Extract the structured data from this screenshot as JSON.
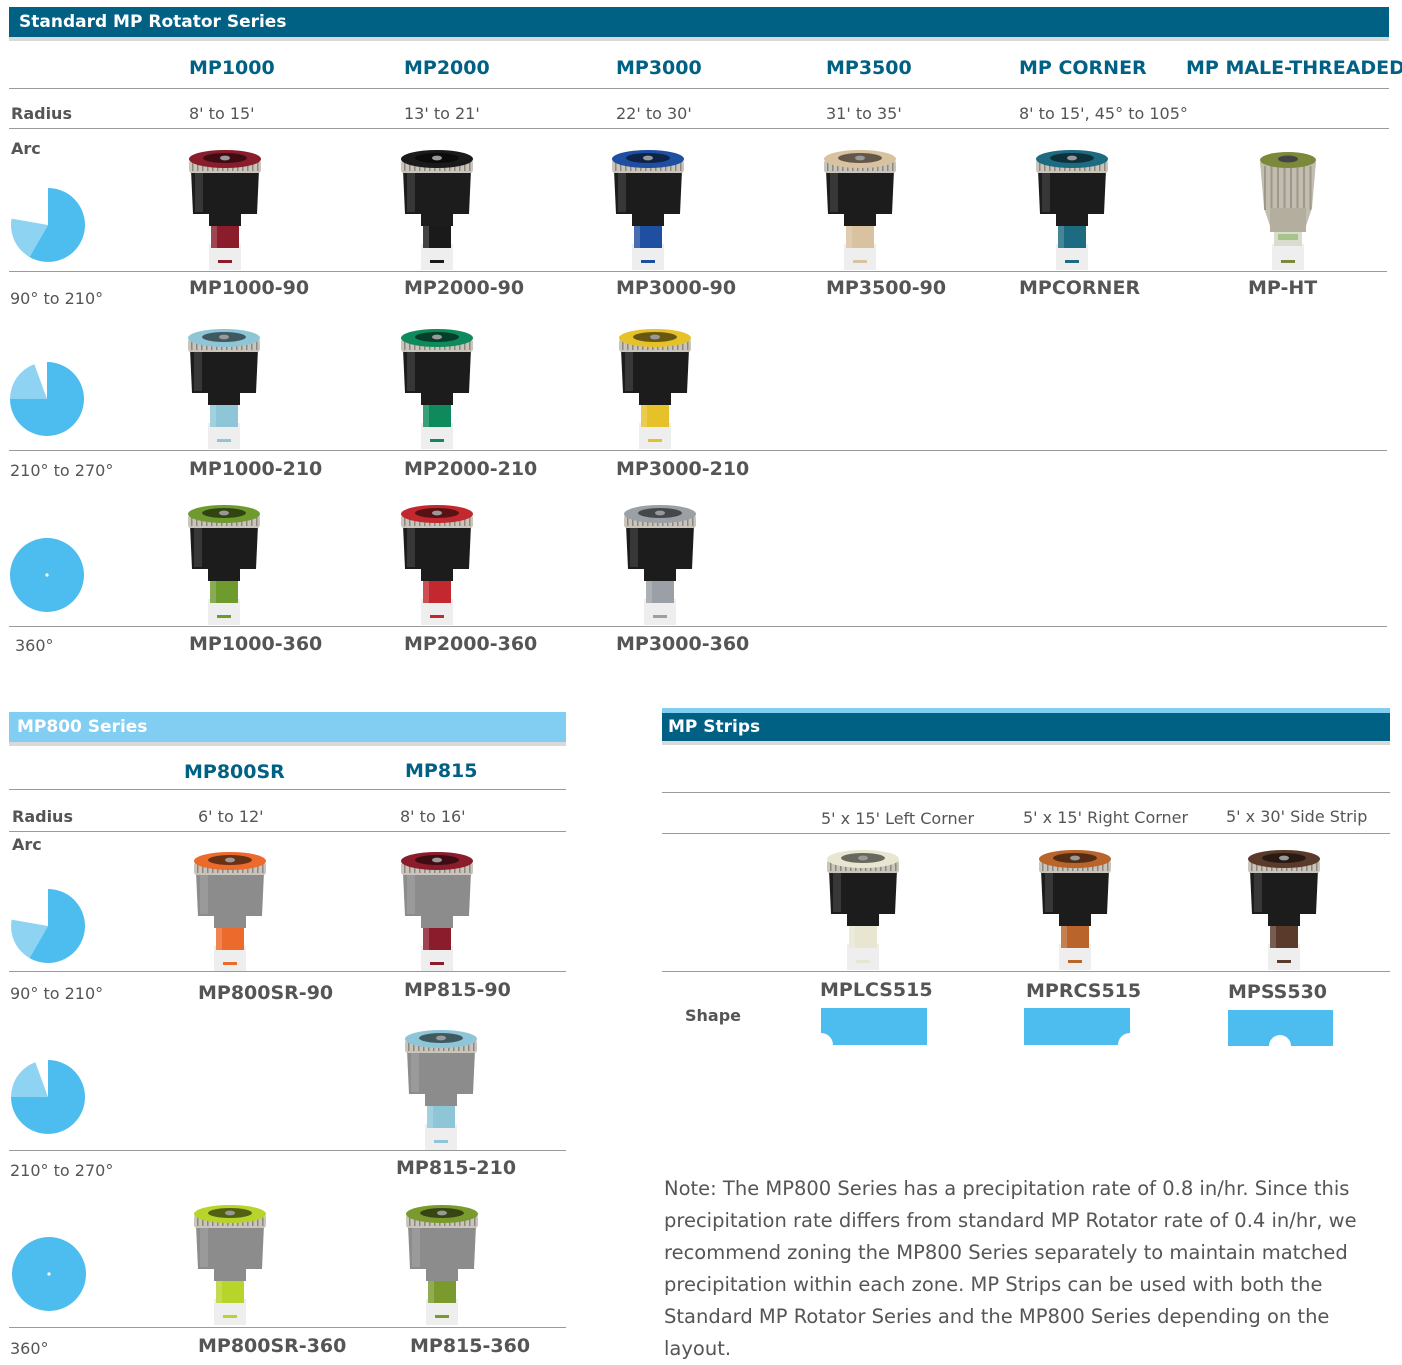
{
  "standard": {
    "title": "Standard MP Rotator Series",
    "columns": [
      "MP1000",
      "MP2000",
      "MP3000",
      "MP3500",
      "MP CORNER",
      "MP MALE-THREADED"
    ],
    "radius_label": "Radius",
    "radius_values": [
      "8' to 15'",
      "13' to 21'",
      "22' to 30'",
      "31' to 35'",
      "8' to 15', 45° to 105°"
    ],
    "arc_label": "Arc",
    "rows": [
      {
        "arc": "90° to 210°",
        "arc_fraction": 0.583,
        "models": [
          "MP1000-90",
          "MP2000-90",
          "MP3000-90",
          "MP3500-90",
          "MPCORNER",
          "MP-HT"
        ],
        "colors": [
          "#8a1c2b",
          "#1a1a1a",
          "#1f4fa0",
          "#d9c2a0",
          "#1d6b80",
          "#7a8a3a"
        ]
      },
      {
        "arc": "210° to 270°",
        "arc_fraction": 0.75,
        "models": [
          "MP1000-210",
          "MP2000-210",
          "MP3000-210"
        ],
        "colors": [
          "#8ec6d8",
          "#0e8a5c",
          "#e6c228"
        ]
      },
      {
        "arc": "360°",
        "arc_fraction": 1,
        "models": [
          "MP1000-360",
          "MP2000-360",
          "MP3000-360"
        ],
        "colors": [
          "#6e9a2e",
          "#c3282e",
          "#9aa0a6"
        ]
      }
    ]
  },
  "mp800": {
    "title": "MP800 Series",
    "columns": [
      "MP800SR",
      "MP815"
    ],
    "radius_label": "Radius",
    "radius_values": [
      "6' to 12'",
      "8' to 16'"
    ],
    "arc_label": "Arc",
    "rows": [
      {
        "arc": "90° to 210°",
        "arc_fraction": 0.583,
        "models": [
          "MP800SR-90",
          "MP815-90"
        ],
        "colors": [
          "#ec6a2c",
          "#8a1c2b"
        ]
      },
      {
        "arc": "210° to 270°",
        "arc_fraction": 0.75,
        "models": [
          "",
          "MP815-210"
        ],
        "colors": [
          "",
          "#8ec6d8"
        ]
      },
      {
        "arc": "360°",
        "arc_fraction": 1,
        "models": [
          "MP800SR-360",
          "MP815-360"
        ],
        "colors": [
          "#b6d42a",
          "#7a9a2e"
        ]
      }
    ]
  },
  "strips": {
    "title": "MP Strips",
    "columns": [
      "5' x 15' Left Corner",
      "5' x 15' Right Corner",
      "5' x 30' Side Strip"
    ],
    "models": [
      "MPLCS515",
      "MPRCS515",
      "MPSS530"
    ],
    "colors": [
      "#e8e6d0",
      "#b8642a",
      "#5a3a2a"
    ],
    "shape_label": "Shape"
  },
  "note": "Note: The MP800 Series has a precipitation rate of 0.8 in/hr. Since this precipitation rate differs from standard MP Rotator rate of 0.4 in/hr, we recommend zoning the MP800 Series separately to maintain matched precipitation within each zone. MP Strips can be used with both the Standard MP Rotator Series and the MP800 Series depending on the layout.",
  "palette": {
    "dark_blue": "#006184",
    "light_blue": "#82cdf2",
    "arc_blue": "#4cbdee",
    "arc_light": "#8fd3f3",
    "cap_gray": "#8a8a8a"
  }
}
